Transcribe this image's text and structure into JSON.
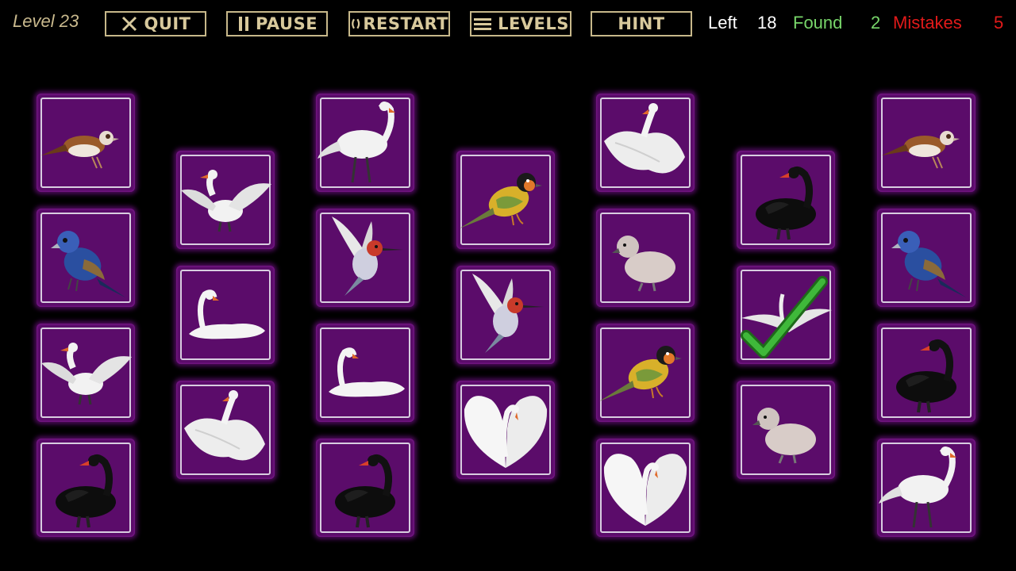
{
  "header": {
    "level_label": "Level 23",
    "buttons": {
      "quit": {
        "label": "QUIT",
        "icon": "close-icon"
      },
      "pause": {
        "label": "PAUSE",
        "icon": "pause-icon"
      },
      "restart": {
        "label": "RESTART",
        "icon": "restart-icon"
      },
      "levels": {
        "label": "LEVELS",
        "icon": "menu-icon"
      },
      "hint": {
        "label": "HINT"
      }
    },
    "stats": {
      "left_label": "Left",
      "left_value": "18",
      "found_label": "Found",
      "found_value": "2",
      "mistakes_label": "Mistakes",
      "mistakes_value": "5"
    }
  },
  "colors": {
    "card_bg": "#5b0c6a",
    "found": "#78d66a",
    "mistakes": "#e21a1a",
    "button_border": "#c7b88a",
    "checkmark": "#2fa22a"
  },
  "board": {
    "columns": [
      [
        "sparrow",
        "blue-grosbeak",
        "white-swan-wings",
        "black-swan"
      ],
      [
        "white-swan-wings",
        "white-swan-floating",
        "white-swan-preening"
      ],
      [
        "white-swan-standing",
        "hummingbird",
        "white-swan-floating",
        "black-swan"
      ],
      [
        "colorful-finch",
        "hummingbird",
        "white-swan-heart"
      ],
      [
        "white-swan-preening",
        "cygnet",
        "colorful-finch",
        "white-swan-heart"
      ],
      [
        "black-swan",
        "matched-checkmark",
        "cygnet"
      ],
      [
        "sparrow",
        "blue-grosbeak",
        "black-swan",
        "white-swan-standing"
      ]
    ]
  }
}
